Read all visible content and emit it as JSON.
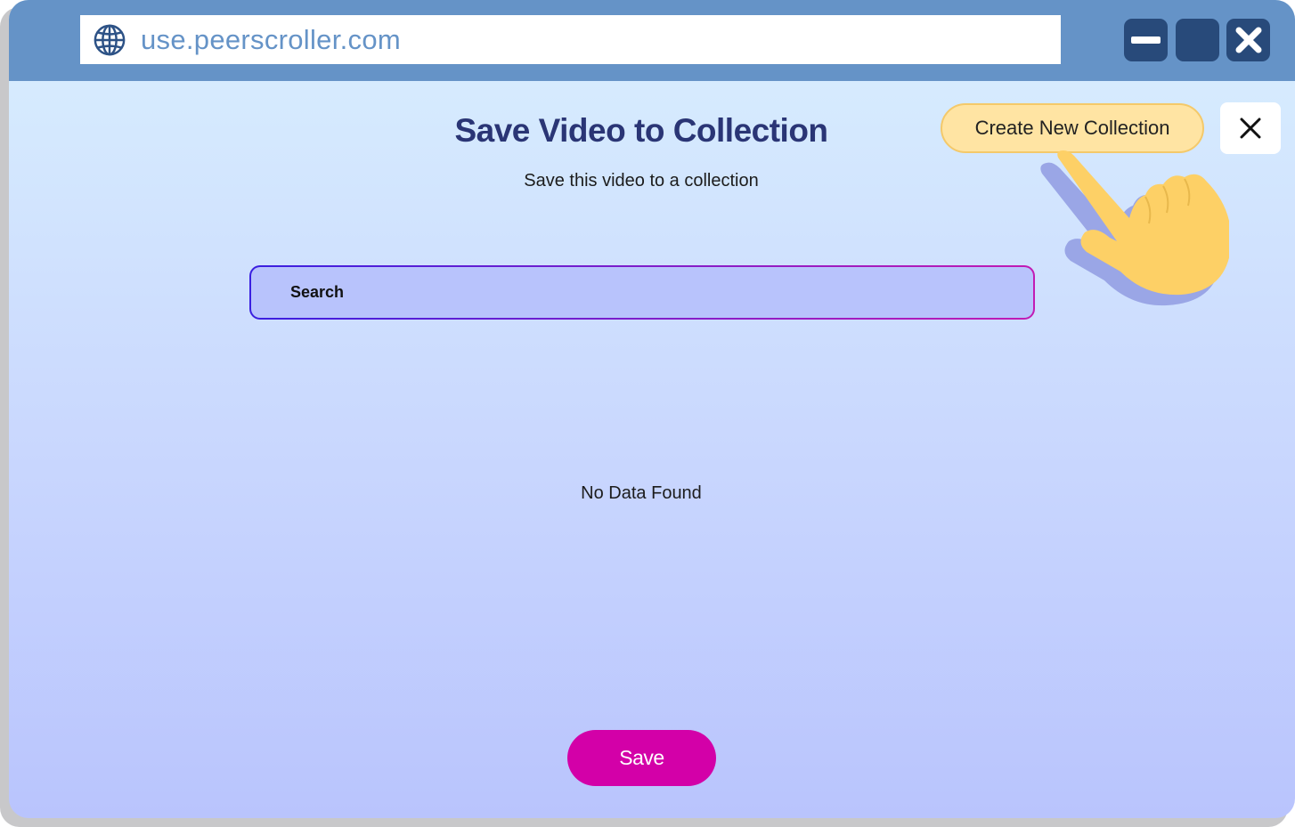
{
  "browser": {
    "url": "use.peerscroller.com",
    "url_icon": "globe-icon",
    "controls": {
      "minimize_icon": "minimize-icon",
      "maximize_icon": "maximize-icon",
      "close_icon": "close-icon"
    }
  },
  "dialog": {
    "title": "Save Video to Collection",
    "subtitle": "Save this video to a collection",
    "create_button_label": "Create New Collection",
    "close_icon": "close-icon",
    "search_placeholder": "Search",
    "empty_message": "No Data Found",
    "save_button_label": "Save"
  },
  "pointer_icon": "pointing-hand-icon",
  "colors": {
    "titlebar": "#6593c7",
    "window_button": "#284a7a",
    "title_text": "#2a3575",
    "create_button_bg": "#ffe4a3",
    "save_button_bg": "#d300a8",
    "search_bg": "#b8c3fc"
  }
}
